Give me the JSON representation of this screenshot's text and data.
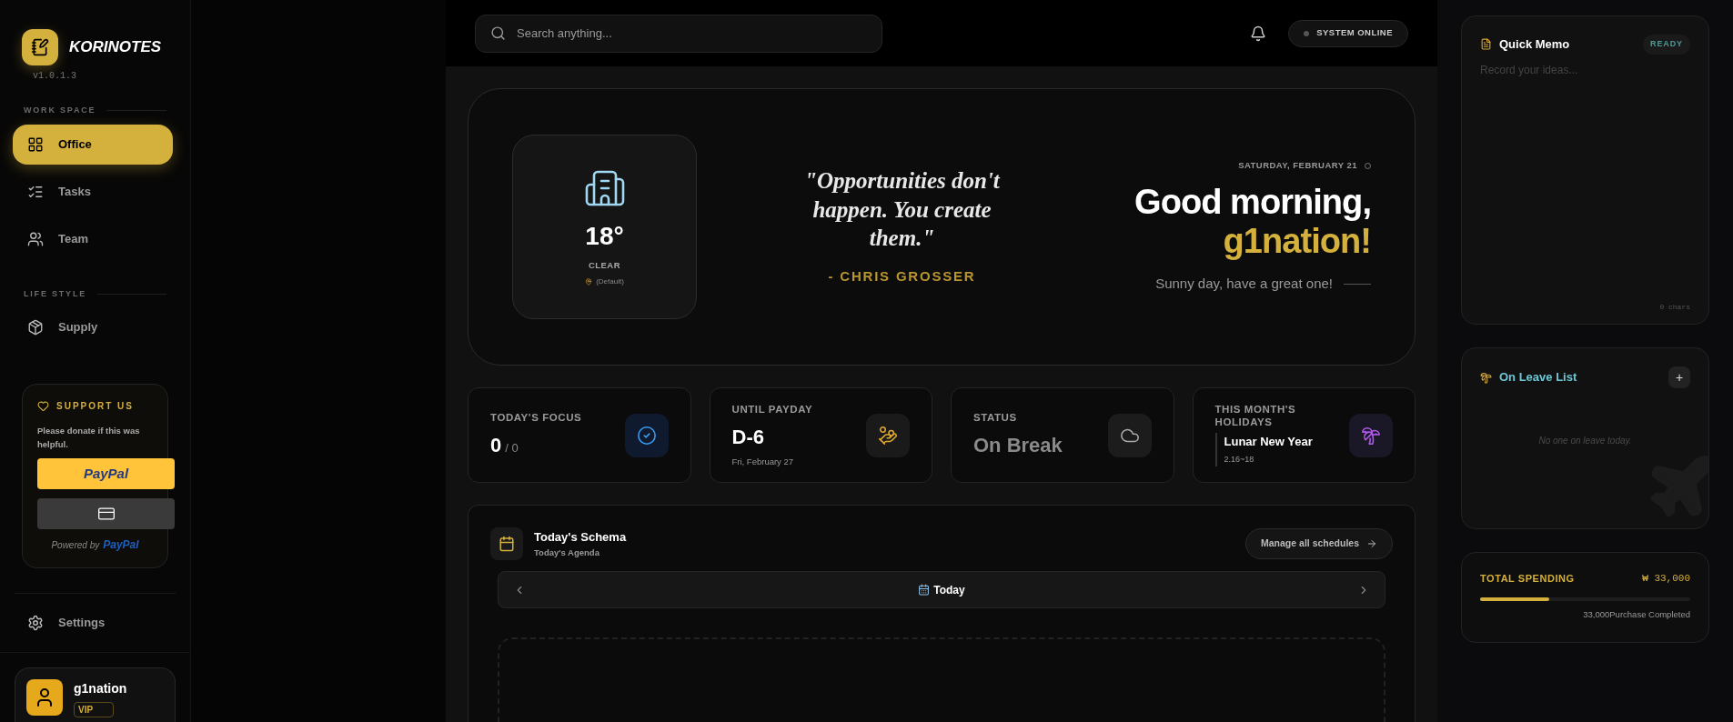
{
  "brand": {
    "name": "KORINOTES",
    "version": "v1.0.1.3"
  },
  "nav_sections": [
    {
      "title": "WORK SPACE",
      "items": [
        {
          "label": "Office",
          "kind": "grid",
          "selected": true
        },
        {
          "label": "Tasks",
          "kind": "tasks",
          "selected": false
        },
        {
          "label": "Team",
          "kind": "team",
          "selected": false
        }
      ]
    },
    {
      "title": "LIFE STYLE",
      "items": [
        {
          "label": "Supply",
          "kind": "box",
          "selected": false
        }
      ]
    }
  ],
  "support": {
    "title": "SUPPORT US",
    "text": "Please donate if this was helpful.",
    "paypal_button": "PayPal",
    "powered_by": "Powered by",
    "powered_brand": "PayPal"
  },
  "settings": {
    "label": "Settings"
  },
  "user": {
    "name": "g1nation",
    "badge": "VIP"
  },
  "search": {
    "placeholder": "Search anything..."
  },
  "system_status": {
    "label": "SYSTEM ONLINE"
  },
  "weather": {
    "temperature": "18°",
    "condition": "CLEAR",
    "location": "(Default)"
  },
  "quote": {
    "text": "\"Opportunities don't happen. You create them.\"",
    "author": "- CHRIS GROSSER"
  },
  "greeting": {
    "date": "SATURDAY, FEBRUARY 21",
    "line1": "Good morning,",
    "name": "g1nation!",
    "subtitle": "Sunny day, have a great one!"
  },
  "stats": [
    {
      "kind": "focus",
      "label": "TODAY'S FOCUS",
      "value": "0",
      "suffix": "/ 0"
    },
    {
      "kind": "payday",
      "label": "UNTIL PAYDAY",
      "value": "D-6",
      "sub": "Fri, February 27"
    },
    {
      "kind": "status",
      "label": "STATUS",
      "value": "On Break"
    },
    {
      "kind": "holiday",
      "label": "THIS MONTH'S HOLIDAYS",
      "value": "Lunar New Year",
      "sub": "2.16~18"
    }
  ],
  "schema": {
    "title": "Today's Schema",
    "subtitle": "Today's Agenda",
    "manage_button": "Manage all schedules",
    "day_label": "Today"
  },
  "memo": {
    "title": "Quick Memo",
    "badge": "READY",
    "placeholder": "Record your ideas...",
    "count": "0 chars"
  },
  "leave": {
    "title": "On Leave List",
    "add": "+",
    "empty": "No one on leave today."
  },
  "spending": {
    "title": "TOTAL SPENDING",
    "amount": "₩ 33,000",
    "level": 0.33,
    "note": "33,000Purchase Completed"
  }
}
